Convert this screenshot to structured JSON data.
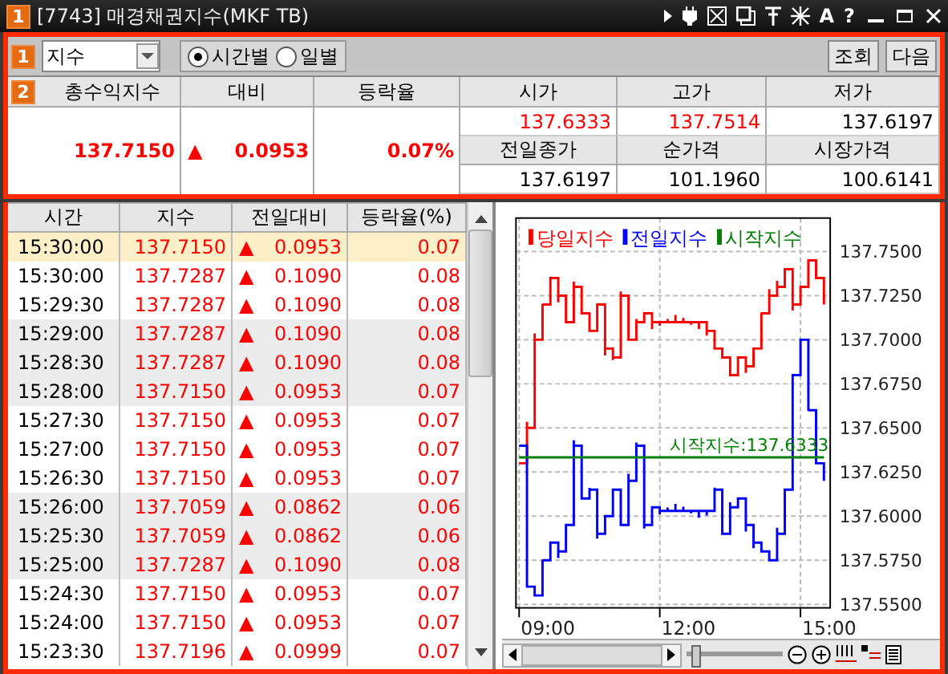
{
  "window": {
    "badge": "1",
    "title": "[7743] 매경채권지수(MKF TB)",
    "tool_glyphs": [
      "A",
      "?"
    ]
  },
  "toolbar": {
    "badge": "1",
    "dropdown": {
      "value": "지수"
    },
    "radios": [
      {
        "label": "시간별",
        "selected": true
      },
      {
        "label": "일별",
        "selected": false
      }
    ],
    "buttons": [
      "조회",
      "다음"
    ]
  },
  "summary": {
    "badge": "2",
    "headers": [
      "총수익지수",
      "대비",
      "등락율"
    ],
    "index": "137.7150",
    "arrow": "▲",
    "change": "0.0953",
    "rate": "0.07%",
    "cells": [
      [
        {
          "label": "시가",
          "value": "137.6333",
          "up": true
        },
        {
          "label": "고가",
          "value": "137.7514",
          "up": true
        },
        {
          "label": "저가",
          "value": "137.6197",
          "up": false
        }
      ],
      [
        {
          "label": "전일종가",
          "value": "137.6197",
          "up": false
        },
        {
          "label": "순가격",
          "value": "101.1960",
          "up": false
        },
        {
          "label": "시장가격",
          "value": "100.6141",
          "up": false
        }
      ]
    ]
  },
  "table": {
    "columns": [
      "시간",
      "지수",
      "전일대비",
      "등락율(%)"
    ],
    "rows": [
      {
        "time": "15:30:00",
        "index": "137.7150",
        "arrow": "▲",
        "change": "0.0953",
        "rate": "0.07",
        "selected": true
      },
      {
        "time": "15:30:00",
        "index": "137.7287",
        "arrow": "▲",
        "change": "0.1090",
        "rate": "0.08",
        "selected": false
      },
      {
        "time": "15:29:30",
        "index": "137.7287",
        "arrow": "▲",
        "change": "0.1090",
        "rate": "0.08",
        "selected": false
      },
      {
        "time": "15:29:00",
        "index": "137.7287",
        "arrow": "▲",
        "change": "0.1090",
        "rate": "0.08",
        "selected": false
      },
      {
        "time": "15:28:30",
        "index": "137.7287",
        "arrow": "▲",
        "change": "0.1090",
        "rate": "0.08",
        "selected": false
      },
      {
        "time": "15:28:00",
        "index": "137.7150",
        "arrow": "▲",
        "change": "0.0953",
        "rate": "0.07",
        "selected": false
      },
      {
        "time": "15:27:30",
        "index": "137.7150",
        "arrow": "▲",
        "change": "0.0953",
        "rate": "0.07",
        "selected": false
      },
      {
        "time": "15:27:00",
        "index": "137.7150",
        "arrow": "▲",
        "change": "0.0953",
        "rate": "0.07",
        "selected": false
      },
      {
        "time": "15:26:30",
        "index": "137.7150",
        "arrow": "▲",
        "change": "0.0953",
        "rate": "0.07",
        "selected": false
      },
      {
        "time": "15:26:00",
        "index": "137.7059",
        "arrow": "▲",
        "change": "0.0862",
        "rate": "0.06",
        "selected": false
      },
      {
        "time": "15:25:30",
        "index": "137.7059",
        "arrow": "▲",
        "change": "0.0862",
        "rate": "0.06",
        "selected": false
      },
      {
        "time": "15:25:00",
        "index": "137.7287",
        "arrow": "▲",
        "change": "0.1090",
        "rate": "0.08",
        "selected": false
      },
      {
        "time": "15:24:30",
        "index": "137.7150",
        "arrow": "▲",
        "change": "0.0953",
        "rate": "0.07",
        "selected": false
      },
      {
        "time": "15:24:00",
        "index": "137.7150",
        "arrow": "▲",
        "change": "0.0953",
        "rate": "0.07",
        "selected": false
      },
      {
        "time": "15:23:30",
        "index": "137.7196",
        "arrow": "▲",
        "change": "0.0999",
        "rate": "0.07",
        "selected": false
      }
    ]
  },
  "chart": {
    "legend": [
      {
        "name": "당일지수",
        "color": "#ff0000"
      },
      {
        "name": "전일지수",
        "color": "#0000ff"
      },
      {
        "name": "시작지수",
        "color": "#008000"
      }
    ],
    "annotation": "시작지수:137.6333",
    "y_labels": [
      "137.7500",
      "137.7250",
      "137.7000",
      "137.6750",
      "137.6500",
      "137.6250",
      "137.6000",
      "137.5750",
      "137.5500"
    ],
    "x_labels": [
      "09:00",
      "12:00",
      "15:00"
    ],
    "zoom_slider": {
      "level": 0.03
    }
  }
}
